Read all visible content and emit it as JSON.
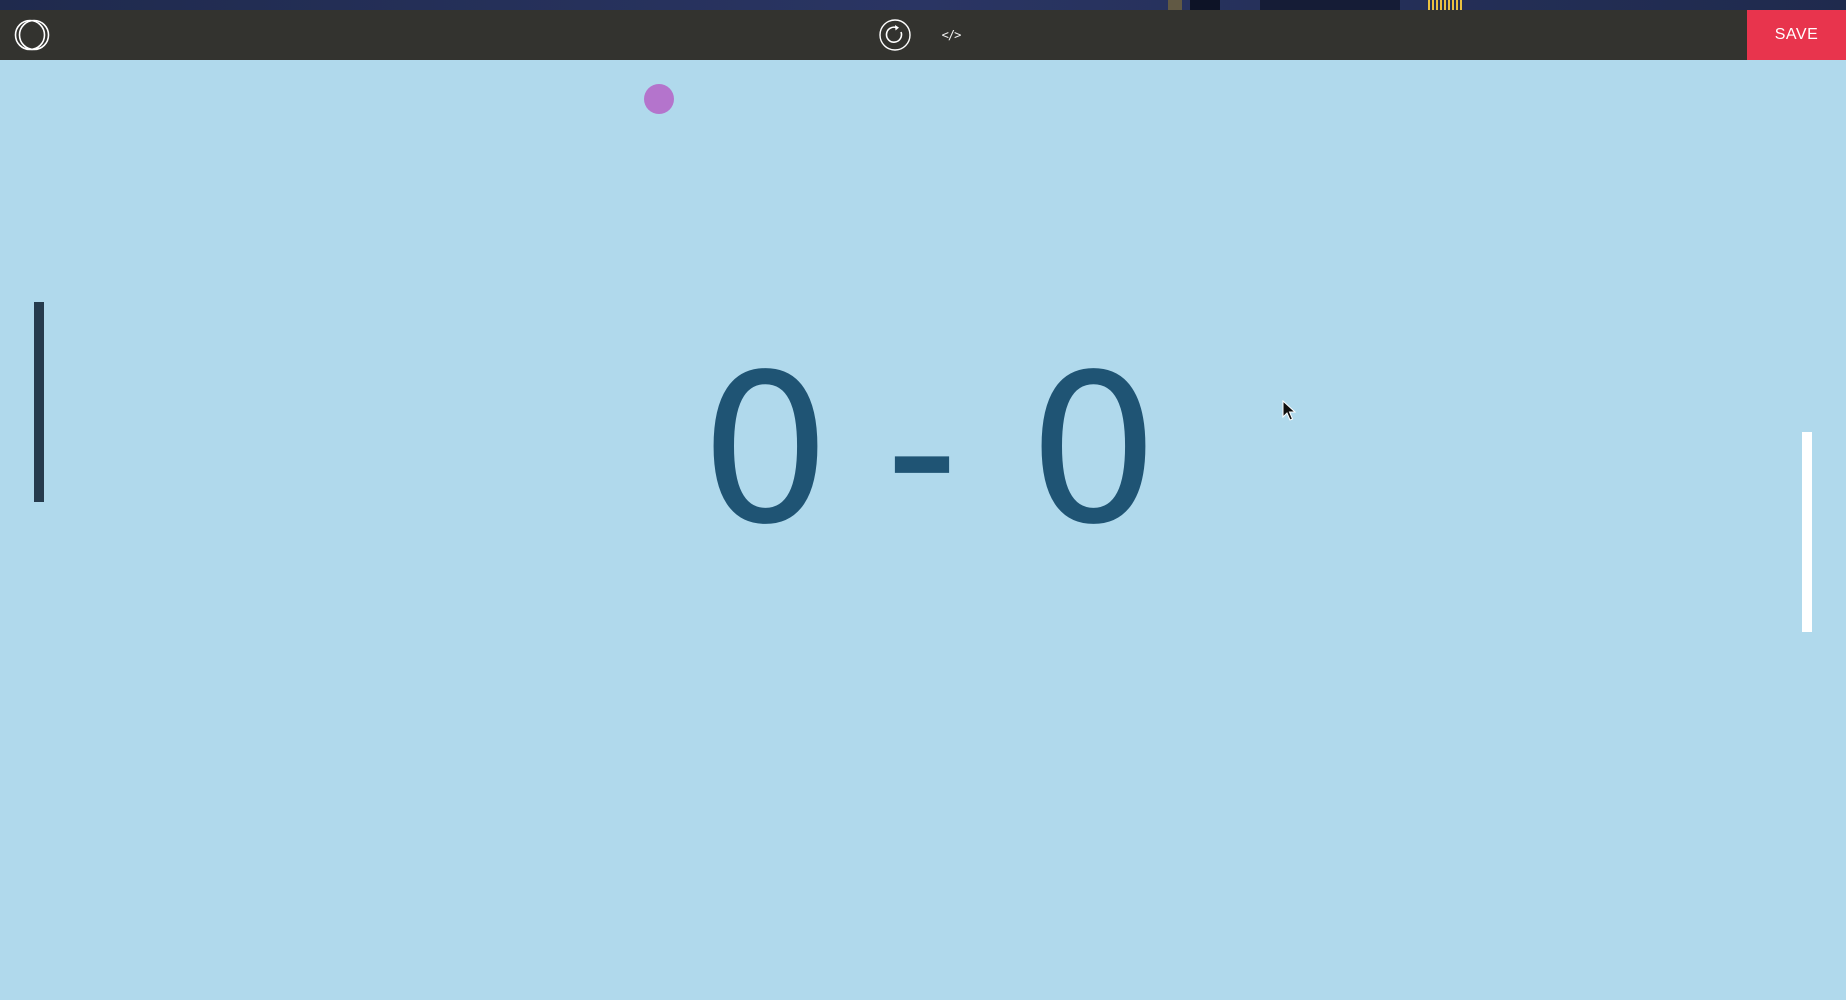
{
  "toolbar": {
    "logo_icon": "double-circle-logo",
    "reload_icon": "reload-icon",
    "code_label": "</>",
    "save_label": "SAVE"
  },
  "game": {
    "score": {
      "left": "0",
      "separator": "-",
      "right": "0"
    }
  },
  "colors": {
    "toolbar_bg": "#33332f",
    "save_bg": "#e8344d",
    "field_bg": "#b0d9ec",
    "score_text": "#1f5474",
    "ball": "#b474cc",
    "left_paddle": "#263b4d",
    "right_paddle": "#ffffff"
  }
}
